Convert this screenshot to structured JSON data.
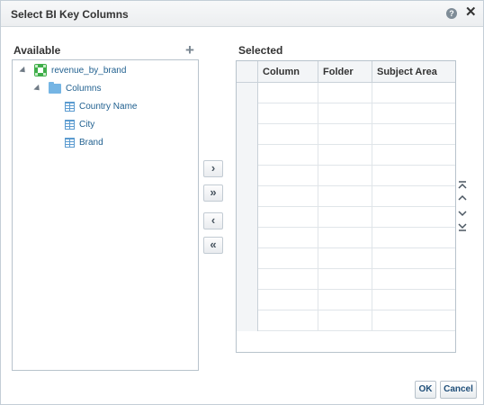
{
  "dialog": {
    "title": "Select BI Key Columns",
    "help_icon": "question-mark-icon",
    "close_icon": "close-icon",
    "close_glyph": "✕",
    "help_glyph": "?"
  },
  "available": {
    "label": "Available",
    "add_icon": "plus-icon",
    "add_glyph": "+",
    "tree": {
      "root": "revenue_by_brand",
      "folder": "Columns",
      "columns": [
        "Country Name",
        "City",
        "Brand"
      ]
    }
  },
  "shuttle": {
    "move": "›",
    "move_all": "»",
    "remove": "‹",
    "remove_all": "«"
  },
  "selected": {
    "label": "Selected",
    "headers": [
      "Column",
      "Folder",
      "Subject Area"
    ],
    "row_count": 12
  },
  "reorder": [
    "move-top-icon",
    "move-up-icon",
    "move-down-icon",
    "move-bottom-icon"
  ],
  "footer": {
    "ok_label": "OK",
    "cancel_label": "Cancel"
  },
  "colors": {
    "accent": "#1f5f8f",
    "folder": "#75b5e4",
    "data_source": "#3fae49"
  }
}
